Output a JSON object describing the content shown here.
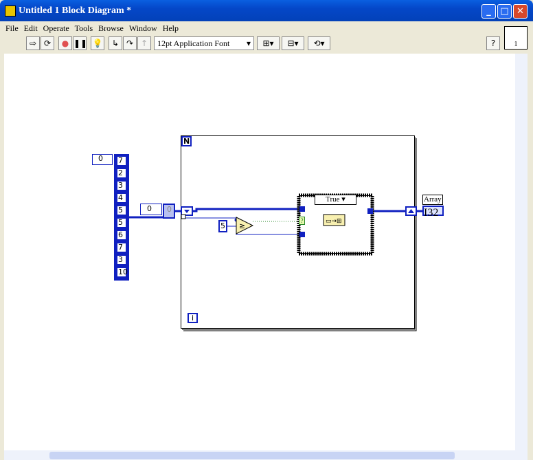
{
  "window": {
    "title": "Untitled 1 Block Diagram *",
    "minimize": "_",
    "maximize": "□",
    "close": "✕"
  },
  "menu": [
    "File",
    "Edit",
    "Operate",
    "Tools",
    "Browse",
    "Window",
    "Help"
  ],
  "toolbar": {
    "font": "12pt Application Font",
    "help": "?",
    "connector_index": "1"
  },
  "diagram": {
    "array_index": "0",
    "array_values": [
      "7",
      "2",
      "3",
      "4",
      "5",
      "5",
      "6",
      "7",
      "3",
      "10"
    ],
    "index_control": "0",
    "index_element": "0",
    "loop_count_label": "N",
    "loop_iteration_label": "i",
    "constant": "5",
    "case_selector": "True",
    "selector_value": "?",
    "indicator_label": "Array",
    "indicator_type": "I32"
  },
  "colors": {
    "wire": "#1020c0",
    "titlebar": "#0447c8"
  }
}
